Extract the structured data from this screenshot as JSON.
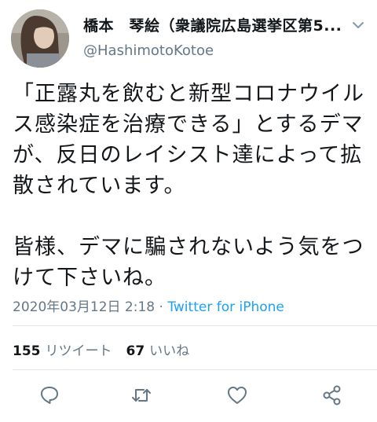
{
  "tweet": {
    "display_name": "橋本　琴絵（衆議院広島選挙区第5...",
    "handle": "@HashimotoKotoe",
    "text": "「正露丸を飲むと新型コロナウイルス感染症を治療できる」とするデマが、反日のレイシスト達によって拡散されています。\n\n皆様、デマに騙されないよう気をつけて下さいね。",
    "timestamp": "2020年03月12日 2:18",
    "separator": " · ",
    "source": "Twitter for iPhone",
    "retweets_count": "155",
    "retweets_label": "リツイート",
    "likes_count": "67",
    "likes_label": "いいね"
  },
  "icons": {
    "chevron": "chevron-down-icon",
    "reply": "reply-icon",
    "retweet": "retweet-icon",
    "like": "heart-icon",
    "share": "share-icon"
  },
  "colors": {
    "text": "#14171a",
    "secondary": "#657786",
    "link": "#1da1f2",
    "divider": "#e1e8ed"
  }
}
